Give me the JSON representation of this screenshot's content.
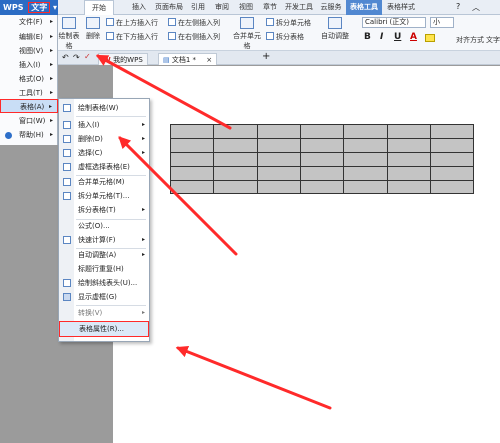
{
  "app": {
    "logo": "WPS",
    "app_menu": "文字"
  },
  "tabs": [
    "开始",
    "插入",
    "页面布局",
    "引用",
    "审阅",
    "视图",
    "章节",
    "开发工具",
    "云服务",
    "表格工具",
    "表格样式"
  ],
  "ribbon": {
    "draw_table": "绘制表格",
    "delete": "删除",
    "insert_above": "在上方插入行",
    "insert_below": "在下方插入行",
    "insert_left": "在左侧插入列",
    "insert_right": "在右侧插入列",
    "merge_cells": "合并单元格",
    "split_cells": "拆分单元格",
    "split_table": "拆分表格",
    "auto_fit": "自动调整",
    "font": "Calibri (正文)",
    "font_size": "小",
    "align": "对齐方式",
    "text_dir": "文字",
    "bold": "B",
    "italic": "I",
    "underline": "U",
    "font_color": "A"
  },
  "doc_tabs": [
    "我的WPS",
    "文档1 *"
  ],
  "main_menu": [
    {
      "label": "文件(F)"
    },
    {
      "label": "编辑(E)"
    },
    {
      "label": "视图(V)"
    },
    {
      "label": "插入(I)"
    },
    {
      "label": "格式(O)"
    },
    {
      "label": "工具(T)"
    },
    {
      "label": "表格(A)"
    },
    {
      "label": "窗口(W)"
    },
    {
      "label": "帮助(H)"
    }
  ],
  "submenu": [
    {
      "label": "绘制表格(W)"
    },
    {
      "label": "插入(I)"
    },
    {
      "label": "删除(D)"
    },
    {
      "label": "选择(C)"
    },
    {
      "label": "虚框选择表格(E)"
    },
    {
      "label": "合并单元格(M)"
    },
    {
      "label": "拆分单元格(T)..."
    },
    {
      "label": "拆分表格(T)"
    },
    {
      "label": "公式(O)..."
    },
    {
      "label": "快速计算(F)"
    },
    {
      "label": "自动调整(A)"
    },
    {
      "label": "标题行重复(H)"
    },
    {
      "label": "绘制斜线表头(U)..."
    },
    {
      "label": "显示虚框(G)"
    },
    {
      "label": "转换(V)"
    },
    {
      "label": "表格属性(R)..."
    }
  ],
  "colors": {
    "accent": "#2b6cc4",
    "annotation": "#ff2a2a",
    "table_fill": "#c4c4c4"
  },
  "table": {
    "rows": 5,
    "cols": 7
  }
}
